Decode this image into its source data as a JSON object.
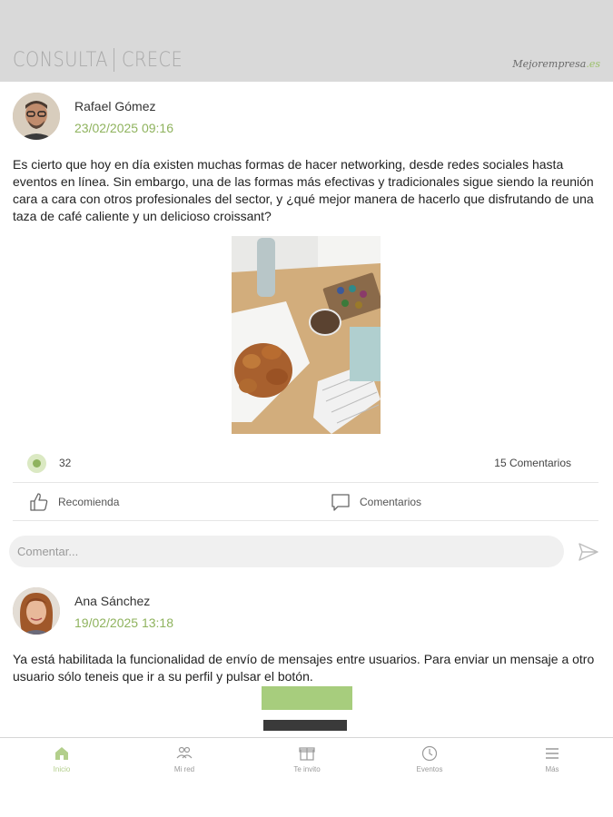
{
  "header": {
    "logo_left_1": "CONSULTA",
    "logo_left_2": "CRECE",
    "logo_right_main": "Mejorempresa",
    "logo_right_suffix": ".es"
  },
  "posts": [
    {
      "author": "Rafael Gómez",
      "date": "23/02/2025 09:16",
      "text": "Es cierto que hoy en día existen muchas formas de hacer networking, desde redes sociales hasta eventos en línea. Sin embargo, una de las formas más efectivas y tradicionales sigue siendo la reunión cara a cara con otros profesionales del sector, y ¿qué mejor manera de hacerlo que disfrutando de una taza de café caliente y un delicioso croissant?",
      "likes": "32",
      "comments": "15 Comentarios",
      "recommend_label": "Recomienda",
      "comments_label": "Comentarios"
    },
    {
      "author": "Ana Sánchez",
      "date": "19/02/2025 13:18",
      "text": "Ya está habilitada la funcionalidad de envío de mensajes entre usuarios. Para enviar un mensaje a otro usuario sólo teneis que ir a su perfil y pulsar el botón."
    }
  ],
  "comment_input": {
    "placeholder": "Comentar..."
  },
  "tabbar": {
    "items": [
      {
        "label": "Inicio",
        "icon": "home-icon",
        "active": true
      },
      {
        "label": "Mi red",
        "icon": "network-icon"
      },
      {
        "label": "Te invito",
        "icon": "invite-icon"
      },
      {
        "label": "Eventos",
        "icon": "clock-icon"
      },
      {
        "label": "Más",
        "icon": "menu-icon"
      }
    ]
  },
  "colors": {
    "accent": "#8fb35e",
    "header_bg": "#d9d9d9"
  }
}
